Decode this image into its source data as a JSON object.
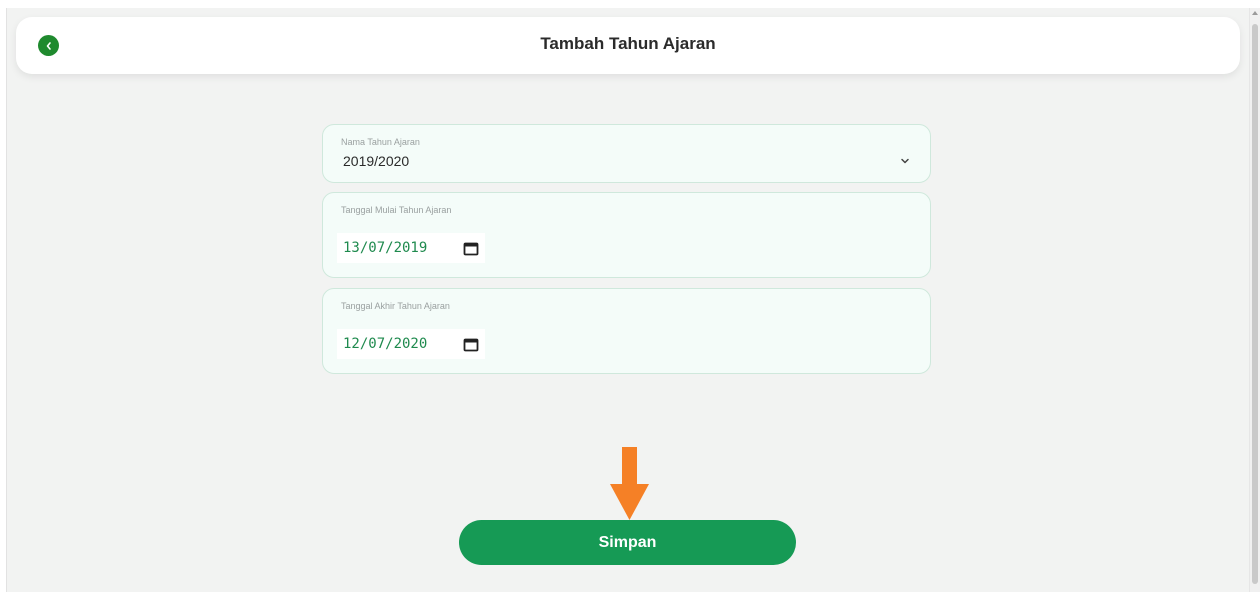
{
  "header": {
    "title": "Tambah Tahun Ajaran"
  },
  "form": {
    "academic_year": {
      "label": "Nama Tahun Ajaran",
      "value": "2019/2020"
    },
    "start_date": {
      "label": "Tanggal Mulai Tahun Ajaran",
      "value": "13/07/2019"
    },
    "end_date": {
      "label": "Tanggal Akhir Tahun Ajaran",
      "value": "12/07/2020"
    }
  },
  "actions": {
    "save_label": "Simpan"
  },
  "icons": {
    "back": "chevron-left-icon",
    "dropdown": "chevron-down-icon",
    "calendar": "calendar-icon",
    "annotation": "arrow-down-icon"
  },
  "colors": {
    "primary": "#169a55",
    "back_button": "#1f8a2e",
    "date_text": "#1f8a4e",
    "annotation_arrow": "#f58026",
    "field_bg": "#f4fcf9",
    "field_border": "#cfe8dc"
  }
}
